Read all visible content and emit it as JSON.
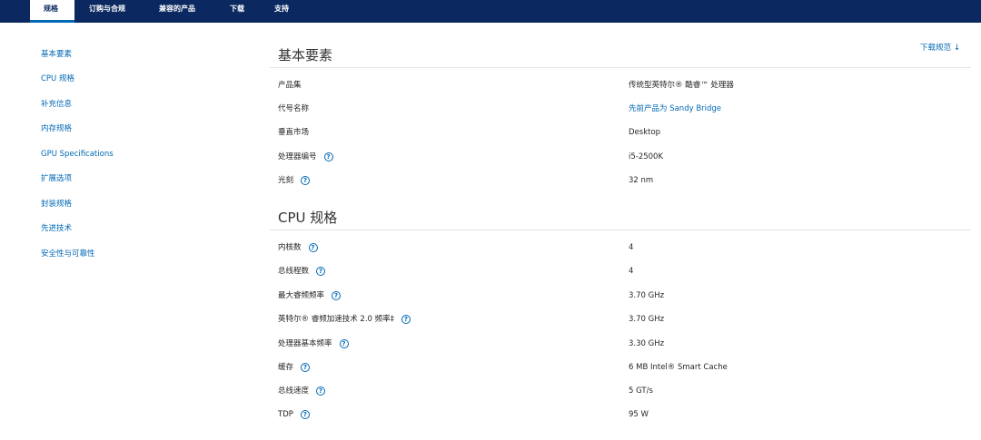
{
  "topnav": {
    "tabs": [
      "规格",
      "订购与合规",
      "兼容的产品",
      "下载",
      "支持"
    ]
  },
  "sidebar": {
    "items": [
      "基本要素",
      "CPU 规格",
      "补充信息",
      "内存规格",
      "GPU Specifications",
      "扩展选项",
      "封装规格",
      "先进技术",
      "安全性与可靠性"
    ]
  },
  "download": {
    "label": "下载规范",
    "arrow": "↓"
  },
  "sections": [
    {
      "title": "基本要素",
      "rows": [
        {
          "label": "产品集",
          "value": "传统型英特尔® 酷睿™ 处理器",
          "help": false,
          "link": false
        },
        {
          "label": "代号名称",
          "value": "先前产品为 Sandy Bridge",
          "help": false,
          "link": true
        },
        {
          "label": "垂直市场",
          "value": "Desktop",
          "help": false,
          "link": false
        },
        {
          "label": "处理器编号",
          "value": "i5-2500K",
          "help": true,
          "link": false
        },
        {
          "label": "光刻",
          "value": "32 nm",
          "help": true,
          "link": false
        }
      ]
    },
    {
      "title": "CPU 规格",
      "rows": [
        {
          "label": "内核数",
          "value": "4",
          "help": true,
          "link": false
        },
        {
          "label": "总线程数",
          "value": "4",
          "help": true,
          "link": false
        },
        {
          "label": "最大睿频频率",
          "value": "3.70 GHz",
          "help": true,
          "link": false
        },
        {
          "label": "英特尔® 睿频加速技术 2.0 频率‡",
          "value": "3.70 GHz",
          "help": true,
          "link": false
        },
        {
          "label": "处理器基本频率",
          "value": "3.30 GHz",
          "help": true,
          "link": false
        },
        {
          "label": "缓存",
          "value": "6 MB Intel® Smart Cache",
          "help": true,
          "link": false
        },
        {
          "label": "总线速度",
          "value": "5 GT/s",
          "help": true,
          "link": false
        },
        {
          "label": "TDP",
          "value": "95 W",
          "help": true,
          "link": false
        }
      ]
    }
  ],
  "help_glyph": "?",
  "colors": {
    "nav_bg": "#0b2960",
    "link": "#0068b5",
    "text": "#262626",
    "rule": "#e4e4e4"
  }
}
